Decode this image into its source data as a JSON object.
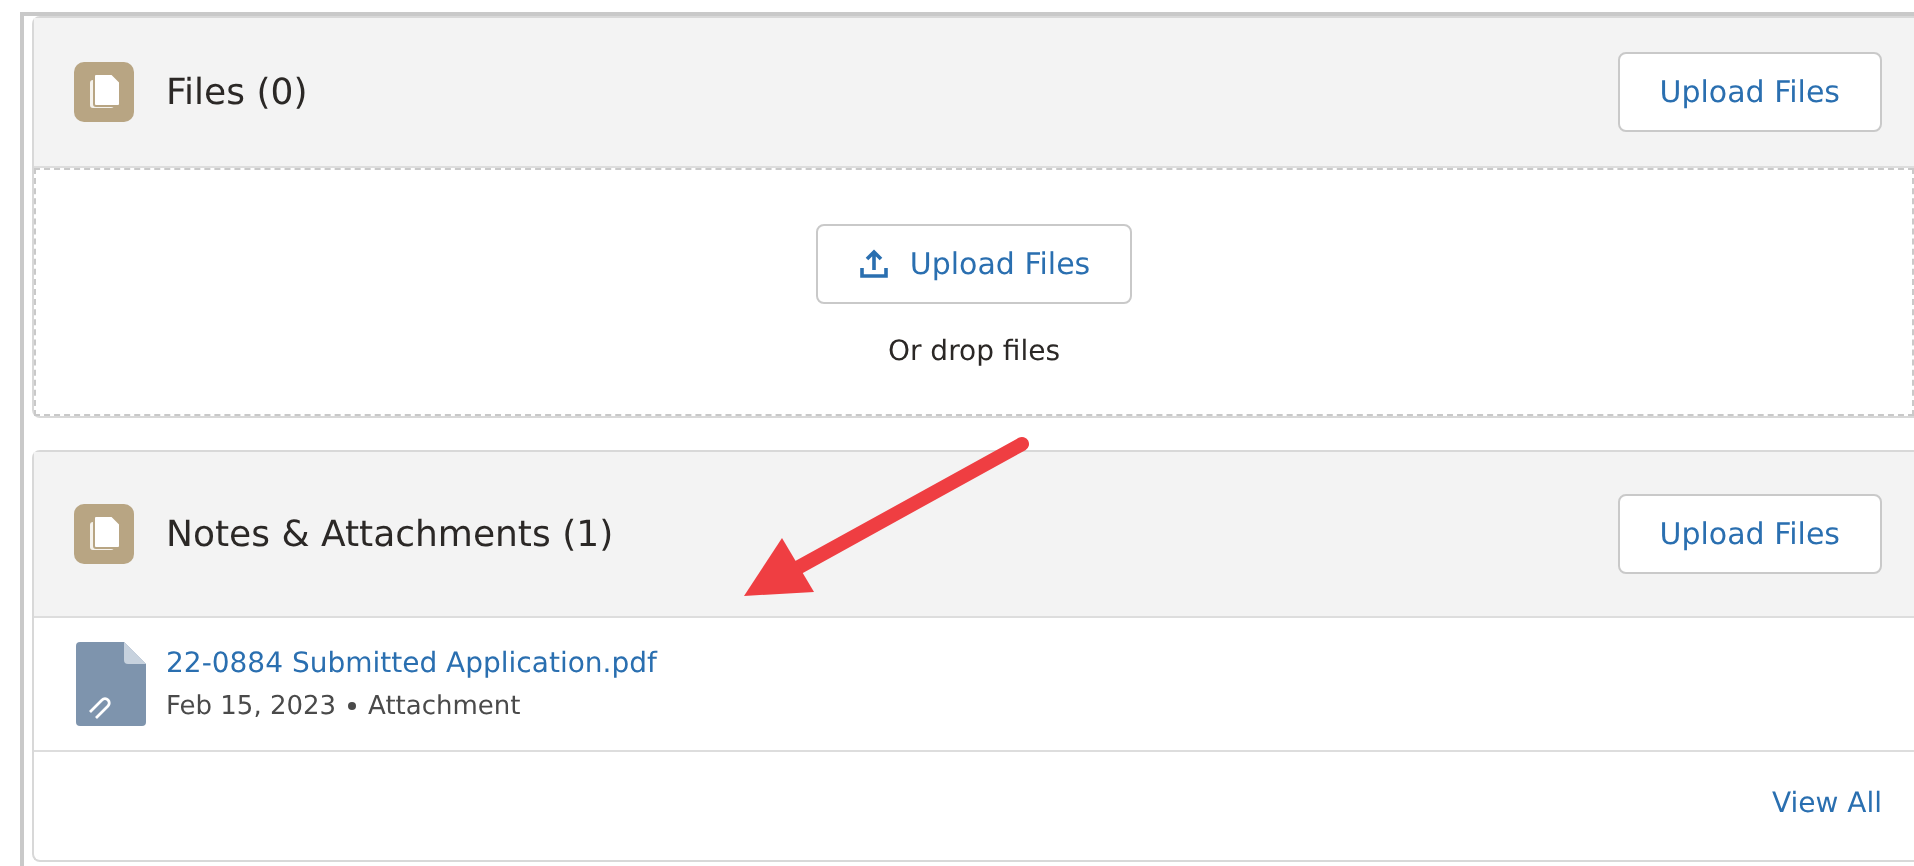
{
  "files_card": {
    "title": "Files (0)",
    "header_button": "Upload Files",
    "dropzone": {
      "button": "Upload Files",
      "hint": "Or drop files"
    }
  },
  "notes_card": {
    "title": "Notes & Attachments (1)",
    "header_button": "Upload Files",
    "items": [
      {
        "name": "22-0884 Submitted Application.pdf",
        "date": "Feb 15, 2023",
        "type": "Attachment"
      }
    ],
    "footer_link": "View All"
  }
}
